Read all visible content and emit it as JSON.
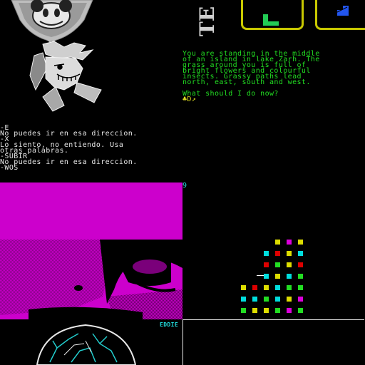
{
  "adventure": {
    "title_fragment": "TE",
    "description": "You are standing in the middle\nof an island in lake Zarh. The\ngrass around you is full of\nbright flowers and colourful\ninsects. Grassy paths lead\nnorth, east, south and west.",
    "prompt": "What should I do now?",
    "input": "♣D↗"
  },
  "spanish_log": {
    "lines": "-E\nNo puedes ir en esa direccion.\n-X\nLo siento, no entiendo. Usa\notras palabras.\n-SUBIR\nNo puedes ir en esa direccion.\n-WOS"
  },
  "status": {
    "counter": "9",
    "logo": "EDDIE"
  },
  "colors": {
    "magenta": "#cc00cc",
    "green": "#22dd22",
    "yellow": "#dddd00",
    "cyan": "#00dddd",
    "red": "#dd0000",
    "frame": "#c8c800"
  },
  "icons": {
    "inventory_left": "green-l-block-icon",
    "inventory_right": "blue-stairs-icon"
  }
}
